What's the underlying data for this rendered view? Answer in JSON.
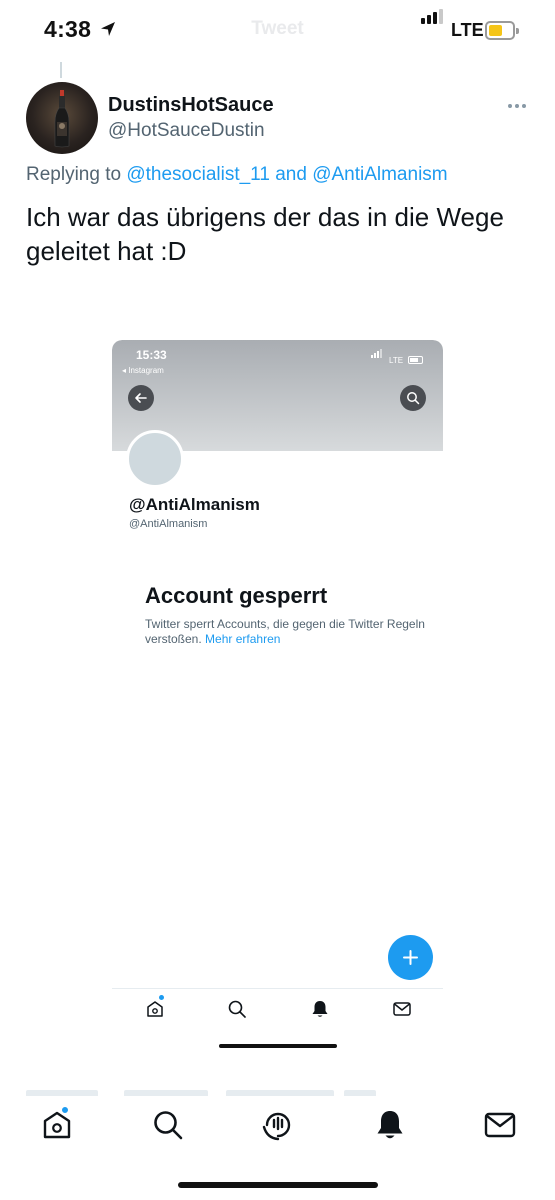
{
  "status_bar": {
    "time": "4:38",
    "network": "LTE",
    "faded_title": "Tweet",
    "battery_color": "#f5c518",
    "icons": [
      "location-arrow-icon",
      "signal-icon",
      "battery-icon"
    ]
  },
  "tweet": {
    "display_name": "DustinsHotSauce",
    "handle": "@HotSauceDustin",
    "replying_prefix": "Replying to",
    "mention_1": "@thesocialist_11",
    "replying_and": "and",
    "mention_2": "@AntiAlmanism",
    "text": "Ich war das übrigens der das in die Wege geleitet hat :D",
    "mention_color": "#1d9bf0"
  },
  "embedded_screenshot": {
    "time": "15:33",
    "back_app": "◂ Instagram",
    "network": "LTE",
    "profile_name": "@AntiAlmanism",
    "profile_handle": "@AntiAlmanism",
    "suspended_title": "Account gesperrt",
    "suspended_text": "Twitter sperrt Accounts, die gegen die Twitter Regeln verstoßen.",
    "suspended_link": "Mehr erfahren",
    "icons": [
      "back-arrow-icon",
      "search-icon",
      "compose-plus-icon",
      "home-icon",
      "search-icon",
      "bell-icon",
      "mail-icon"
    ]
  },
  "tab_bar": {
    "icons": [
      "home-icon",
      "search-icon",
      "spaces-icon",
      "bell-icon",
      "mail-icon"
    ],
    "accent_color": "#1d9bf0"
  }
}
